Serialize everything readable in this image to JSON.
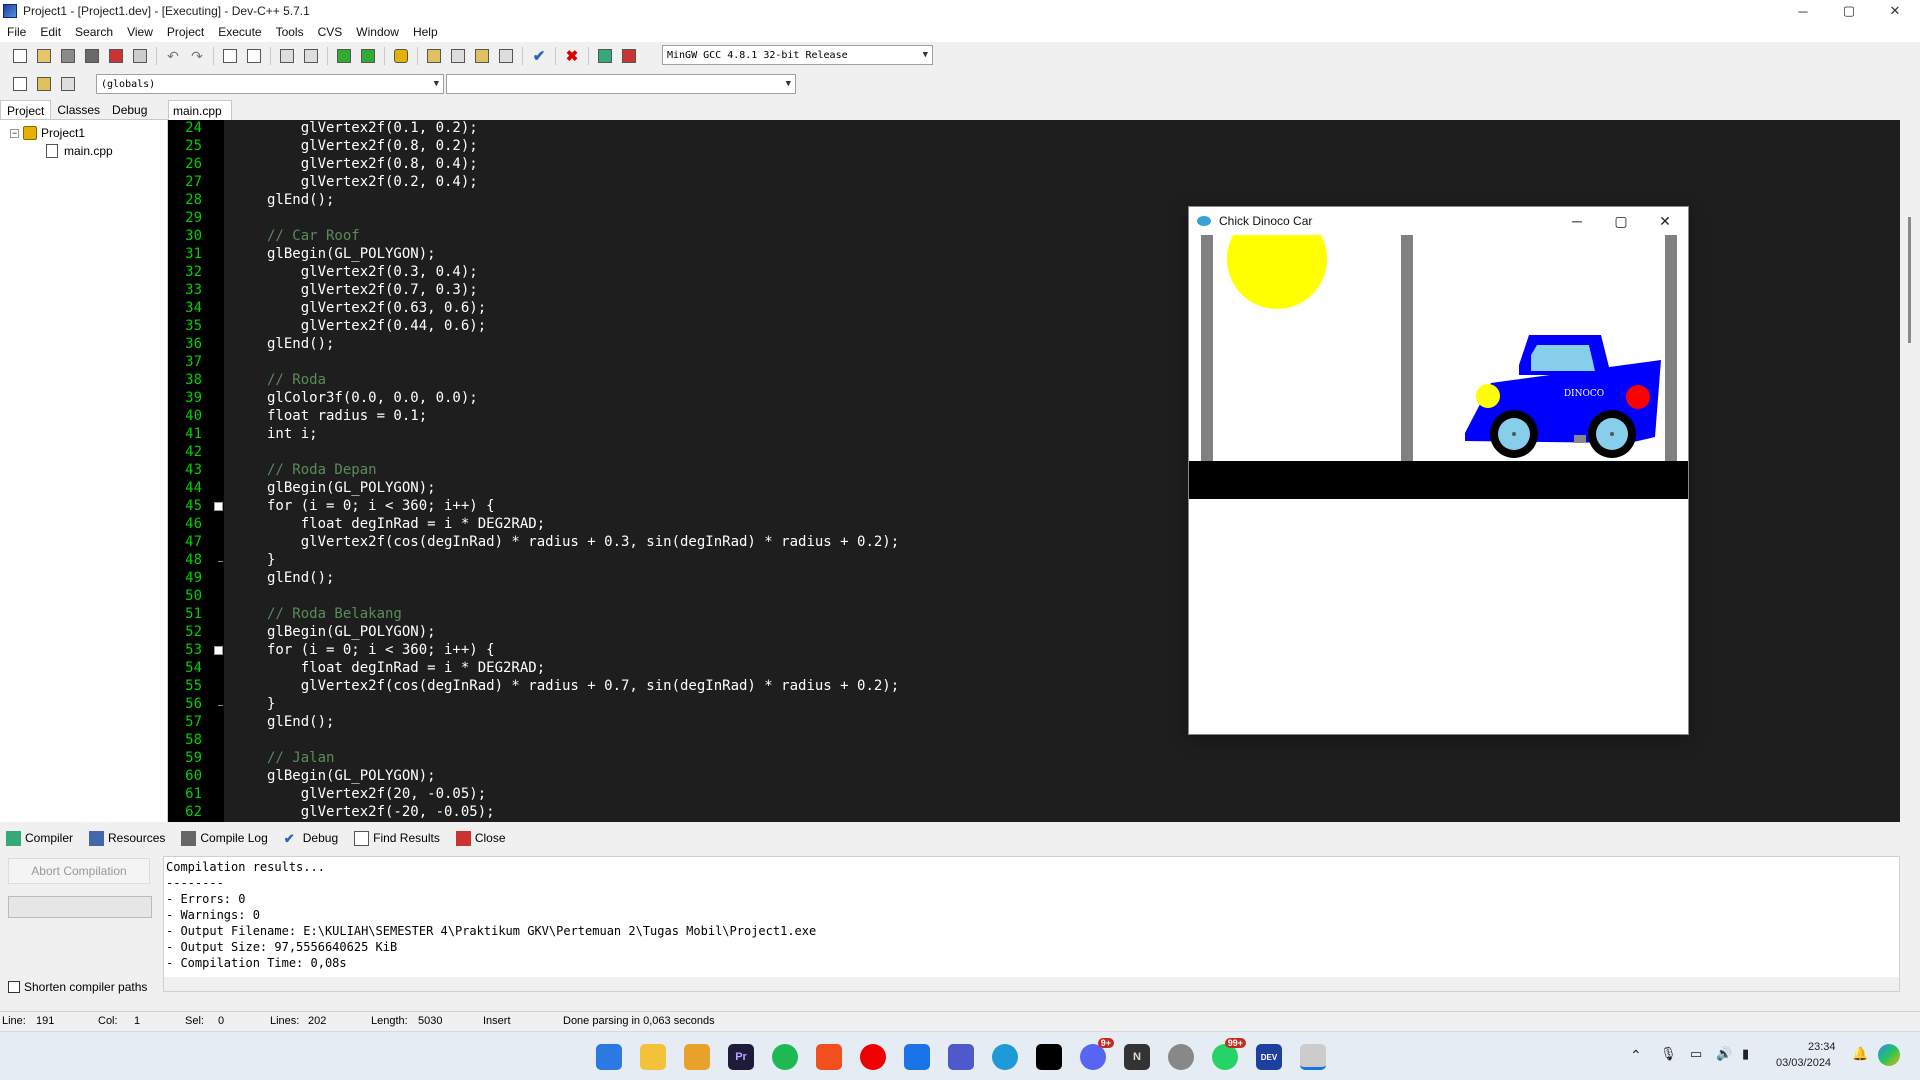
{
  "window": {
    "title": "Project1 - [Project1.dev] - [Executing] - Dev-C++ 5.7.1",
    "minimize": "─",
    "maximize": "▢",
    "close": "✕"
  },
  "menu": [
    "File",
    "Edit",
    "Search",
    "View",
    "Project",
    "Execute",
    "Tools",
    "CVS",
    "Window",
    "Help"
  ],
  "toolbar": {
    "compiler_select": "MinGW GCC 4.8.1 32-bit Release",
    "globals_select": "(globals)",
    "members_select": ""
  },
  "left_panel": {
    "tabs": [
      "Project",
      "Classes",
      "Debug"
    ],
    "project_name": "Project1",
    "file_name": "main.cpp"
  },
  "editor": {
    "tab": "main.cpp",
    "lines": [
      {
        "n": "24",
        "text": "    glVertex2f(0.1, 0.2);",
        "comment": false
      },
      {
        "n": "25",
        "text": "    glVertex2f(0.8, 0.2);",
        "comment": false
      },
      {
        "n": "26",
        "text": "    glVertex2f(0.8, 0.4);",
        "comment": false
      },
      {
        "n": "27",
        "text": "    glVertex2f(0.2, 0.4);",
        "comment": false
      },
      {
        "n": "28",
        "text": "glEnd();",
        "comment": false
      },
      {
        "n": "29",
        "text": "",
        "comment": false
      },
      {
        "n": "30",
        "text": "// Car Roof",
        "comment": true
      },
      {
        "n": "31",
        "text": "glBegin(GL_POLYGON);",
        "comment": false
      },
      {
        "n": "32",
        "text": "    glVertex2f(0.3, 0.4);",
        "comment": false
      },
      {
        "n": "33",
        "text": "    glVertex2f(0.7, 0.3);",
        "comment": false
      },
      {
        "n": "34",
        "text": "    glVertex2f(0.63, 0.6);",
        "comment": false
      },
      {
        "n": "35",
        "text": "    glVertex2f(0.44, 0.6);",
        "comment": false
      },
      {
        "n": "36",
        "text": "glEnd();",
        "comment": false
      },
      {
        "n": "37",
        "text": "",
        "comment": false
      },
      {
        "n": "38",
        "text": "// Roda",
        "comment": true
      },
      {
        "n": "39",
        "text": "glColor3f(0.0, 0.0, 0.0);",
        "comment": false
      },
      {
        "n": "40",
        "text": "float radius = 0.1;",
        "comment": false
      },
      {
        "n": "41",
        "text": "int i;",
        "comment": false
      },
      {
        "n": "42",
        "text": "",
        "comment": false
      },
      {
        "n": "43",
        "text": "// Roda Depan",
        "comment": true
      },
      {
        "n": "44",
        "text": "glBegin(GL_POLYGON);",
        "comment": false
      },
      {
        "n": "45",
        "text": "for (i = 0; i < 360; i++) {",
        "comment": false
      },
      {
        "n": "46",
        "text": "    float degInRad = i * DEG2RAD;",
        "comment": false
      },
      {
        "n": "47",
        "text": "    glVertex2f(cos(degInRad) * radius + 0.3, sin(degInRad) * radius + 0.2);",
        "comment": false
      },
      {
        "n": "48",
        "text": "}",
        "comment": false
      },
      {
        "n": "49",
        "text": "glEnd();",
        "comment": false
      },
      {
        "n": "50",
        "text": "",
        "comment": false
      },
      {
        "n": "51",
        "text": "// Roda Belakang",
        "comment": true
      },
      {
        "n": "52",
        "text": "glBegin(GL_POLYGON);",
        "comment": false
      },
      {
        "n": "53",
        "text": "for (i = 0; i < 360; i++) {",
        "comment": false
      },
      {
        "n": "54",
        "text": "    float degInRad = i * DEG2RAD;",
        "comment": false
      },
      {
        "n": "55",
        "text": "    glVertex2f(cos(degInRad) * radius + 0.7, sin(degInRad) * radius + 0.2);",
        "comment": false
      },
      {
        "n": "56",
        "text": "}",
        "comment": false
      },
      {
        "n": "57",
        "text": "glEnd();",
        "comment": false
      },
      {
        "n": "58",
        "text": "",
        "comment": false
      },
      {
        "n": "59",
        "text": "// Jalan",
        "comment": true
      },
      {
        "n": "60",
        "text": "glBegin(GL_POLYGON);",
        "comment": false
      },
      {
        "n": "61",
        "text": "    glVertex2f(20, -0.05);",
        "comment": false
      },
      {
        "n": "62",
        "text": "    glVertex2f(-20, -0.05);",
        "comment": false
      }
    ]
  },
  "gl_window": {
    "title": "Chick Dinoco Car",
    "car_label": "DINOCO",
    "colors": {
      "sun": "#ffff00",
      "car": "#0000ff",
      "roof": "#87ceeb",
      "road": "#000000",
      "pole": "#808080",
      "headlight": "#ffff00",
      "taillight": "#ff0000"
    }
  },
  "bottom_tabs": [
    "Compiler",
    "Resources",
    "Compile Log",
    "Debug",
    "Find Results",
    "Close"
  ],
  "bottom_panel": {
    "abort_button": "Abort Compilation",
    "shorten_label": "Shorten compiler paths",
    "log": [
      "Compilation results...",
      "--------",
      "- Errors: 0",
      "- Warnings: 0",
      "- Output Filename: E:\\KULIAH\\SEMESTER 4\\Praktikum GKV\\Pertemuan 2\\Tugas Mobil\\Project1.exe",
      "- Output Size: 97,5556640625 KiB",
      "- Compilation Time: 0,08s"
    ]
  },
  "status": {
    "line_label": "Line:",
    "line_value": "191",
    "col_label": "Col:",
    "col_value": "1",
    "sel_label": "Sel:",
    "sel_value": "0",
    "lines_label": "Lines:",
    "lines_value": "202",
    "length_label": "Length:",
    "length_value": "5030",
    "mode": "Insert",
    "message": "Done parsing in 0,063 seconds"
  },
  "taskbar": {
    "premiere_label": "Pr",
    "notion_label": "N",
    "devcpp_label": "DEV",
    "discord_badge": "9+",
    "whatsapp_badge": "99+",
    "time": "23:34",
    "date": "03/03/2024"
  }
}
